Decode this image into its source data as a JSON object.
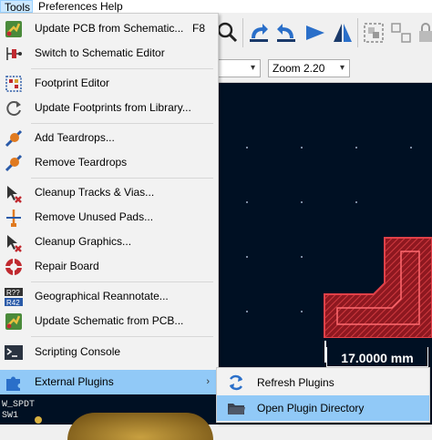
{
  "menubar": {
    "items": [
      "Tools",
      "Preferences",
      "Help"
    ]
  },
  "toolbar": {
    "combo_left_arrow": "▾",
    "zoom_value": "Zoom 2.20"
  },
  "tools_menu": {
    "items": [
      {
        "label": "Update PCB from Schematic...",
        "shortcut": "F8",
        "icon": "update-pcb-icon"
      },
      {
        "label": "Switch to Schematic Editor",
        "icon": "schematic-editor-icon"
      },
      {
        "label": "Footprint Editor",
        "icon": "footprint-editor-icon"
      },
      {
        "label": "Update Footprints from Library...",
        "icon": "refresh-footprints-icon"
      },
      {
        "label": "Add Teardrops...",
        "icon": "teardrop-add-icon"
      },
      {
        "label": "Remove Teardrops",
        "icon": "teardrop-remove-icon"
      },
      {
        "label": "Cleanup Tracks & Vias...",
        "icon": "cleanup-tracks-icon"
      },
      {
        "label": "Remove Unused Pads...",
        "icon": "remove-pads-icon"
      },
      {
        "label": "Cleanup Graphics...",
        "icon": "cleanup-graphics-icon"
      },
      {
        "label": "Repair Board",
        "icon": "repair-board-icon"
      },
      {
        "label": "Geographical Reannotate...",
        "icon": "reannotate-icon"
      },
      {
        "label": "Update Schematic from PCB...",
        "icon": "update-schematic-icon"
      },
      {
        "label": "Scripting Console",
        "icon": "console-icon"
      },
      {
        "label": "External Plugins",
        "icon": "puzzle-icon",
        "submenu_arrow": "›"
      }
    ]
  },
  "plugins_submenu": {
    "items": [
      {
        "label": "Refresh Plugins",
        "icon": "refresh-icon"
      },
      {
        "label": "Open Plugin Directory",
        "icon": "folder-icon"
      }
    ]
  },
  "canvas": {
    "dimension_text": "17.0000 mm",
    "labels": [
      "W_SPDT",
      "SW1"
    ]
  },
  "colors": {
    "menu_highlight": "#91c9f7",
    "canvas_bg": "#001023",
    "copper_red": "#c0202a"
  }
}
